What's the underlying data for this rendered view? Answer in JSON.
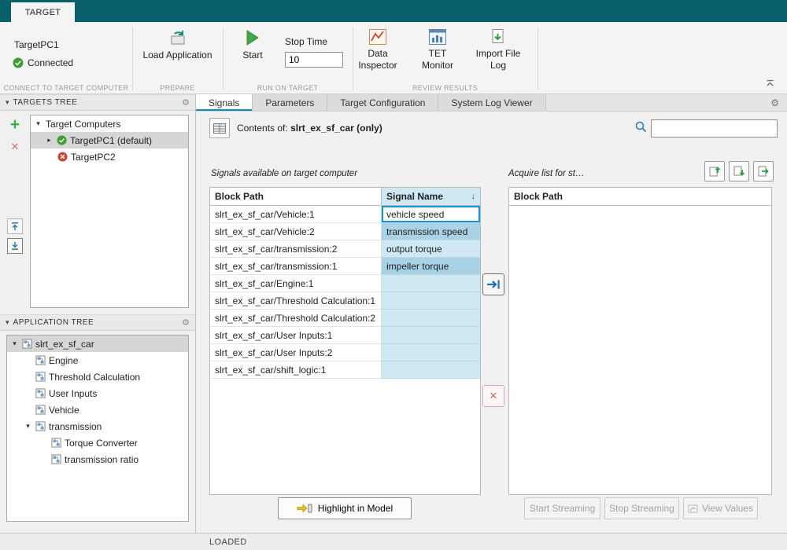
{
  "colors": {
    "titlebar_teal": "#095e6b",
    "accent_blue": "#0d8bc9",
    "signal_cell_blue": "#cfe8f4",
    "signal_cell_selected_blue": "#a9d2e7",
    "status_green": "#3f9c35",
    "status_red": "#d04437"
  },
  "icons": {
    "gear": "⚙",
    "sort_desc": "↓",
    "add": "+",
    "delete": "✕"
  },
  "ribbon": {
    "tab_label": "TARGET",
    "target_name": "TargetPC1",
    "status": "Connected",
    "sections": {
      "connect": "CONNECT TO TARGET COMPUTER",
      "prepare": "PREPARE",
      "run": "RUN ON TARGET",
      "review": "REVIEW RESULTS"
    },
    "load_application": "Load Application",
    "start": "Start",
    "stop_time_label": "Stop Time",
    "stop_time_value": "10",
    "data_inspector": "Data Inspector",
    "tet_monitor": "TET Monitor",
    "import_file_log": "Import File Log"
  },
  "targets_tree": {
    "title": "TARGETS TREE",
    "root": "Target Computers",
    "items": [
      {
        "label": "TargetPC1 (default)",
        "status": "connected"
      },
      {
        "label": "TargetPC2",
        "status": "error"
      }
    ]
  },
  "application_tree": {
    "title": "APPLICATION TREE",
    "root": "slrt_ex_sf_car",
    "items": [
      {
        "label": "Engine"
      },
      {
        "label": "Threshold Calculation"
      },
      {
        "label": "User Inputs"
      },
      {
        "label": "Vehicle"
      },
      {
        "label": "transmission"
      },
      {
        "label": "Torque Converter"
      },
      {
        "label": "transmission ratio"
      }
    ]
  },
  "main": {
    "tabs": [
      {
        "label": "Signals"
      },
      {
        "label": "Parameters"
      },
      {
        "label": "Target Configuration"
      },
      {
        "label": "System Log Viewer"
      }
    ],
    "contents_label": "Contents of:",
    "contents_value": "slrt_ex_sf_car (only)",
    "search_value": "",
    "signals_caption": "Signals available on target computer",
    "acquire_caption": "Acquire list for st…",
    "signals_columns": {
      "path": "Block Path",
      "signal": "Signal Name"
    },
    "acquire_column": "Block Path",
    "signals": [
      {
        "path": "slrt_ex_sf_car/Vehicle:1",
        "signal": "vehicle speed"
      },
      {
        "path": "slrt_ex_sf_car/Vehicle:2",
        "signal": "transmission speed"
      },
      {
        "path": "slrt_ex_sf_car/transmission:2",
        "signal": "output torque"
      },
      {
        "path": "slrt_ex_sf_car/transmission:1",
        "signal": "impeller torque"
      },
      {
        "path": "slrt_ex_sf_car/Engine:1",
        "signal": ""
      },
      {
        "path": "slrt_ex_sf_car/Threshold Calculation:1",
        "signal": ""
      },
      {
        "path": "slrt_ex_sf_car/Threshold Calculation:2",
        "signal": ""
      },
      {
        "path": "slrt_ex_sf_car/User Inputs:1",
        "signal": ""
      },
      {
        "path": "slrt_ex_sf_car/User Inputs:2",
        "signal": ""
      },
      {
        "path": "slrt_ex_sf_car/shift_logic:1",
        "signal": ""
      }
    ],
    "highlight_button": "Highlight in Model",
    "start_streaming": "Start Streaming",
    "stop_streaming": "Stop Streaming",
    "view_values": "View Values"
  },
  "status_bar": {
    "text": "LOADED"
  }
}
